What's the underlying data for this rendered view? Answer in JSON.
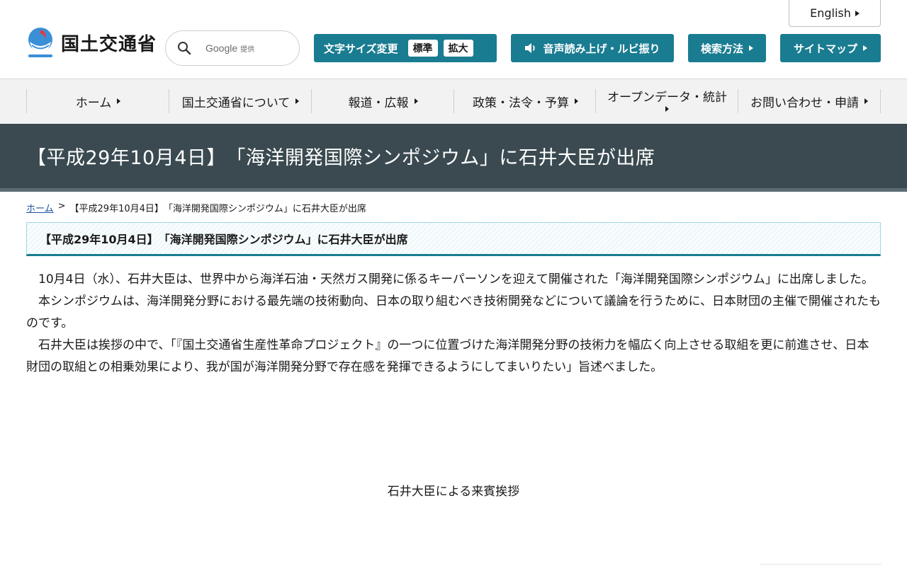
{
  "header": {
    "english_label": "English",
    "logo_text": "国土交通省",
    "search": {
      "provider": "Google",
      "provider_suffix": "提供"
    },
    "font_size": {
      "label": "文字サイズ変更",
      "options": [
        "標準",
        "拡大"
      ]
    },
    "voice_label": "音声読み上げ・ルビ振り",
    "search_method_label": "検索方法",
    "sitemap_label": "サイトマップ",
    "colors": {
      "accent": "#1a7c91",
      "title_band": "#3a4a50"
    }
  },
  "nav": {
    "items": [
      "ホーム",
      "国土交通省について",
      "報道・広報",
      "政策・法令・予算",
      "オープンデータ・統計",
      "お問い合わせ・申請"
    ]
  },
  "page": {
    "title": "【平成29年10月4日】　「海洋開発国際シンポジウム」に石井大臣が出席",
    "breadcrumb": {
      "home": "ホーム",
      "separator": ">",
      "current": "【平成29年10月4日】　「海洋開発国際シンポジウム」に石井大臣が出席"
    },
    "heading": "【平成29年10月4日】　「海洋開発国際シンポジウム」に石井大臣が出席",
    "paragraphs": [
      "10月4日（水）、石井大臣は、世界中から海洋石油・天然ガス開発に係るキーパーソンを迎えて開催された「海洋開発国際シンポジウム」に出席しました。",
      "本シンポジウムは、海洋開発分野における最先端の技術動向、日本の取り組むべき技術開発などについて議論を行うために、日本財団の主催で開催されたものです。",
      "石井大臣は挨拶の中で、「『国土交通省生産性革命プロジェクト』の一つに位置づけた海洋開発分野の技術力を幅広く向上させる取組を更に前進させ、日本財団の取組との相乗効果により、我が国が海洋開発分野で存在感を発揮できるようにしてまいりたい」旨述べました。"
    ],
    "caption": "石井大臣による来賓挨拶"
  }
}
